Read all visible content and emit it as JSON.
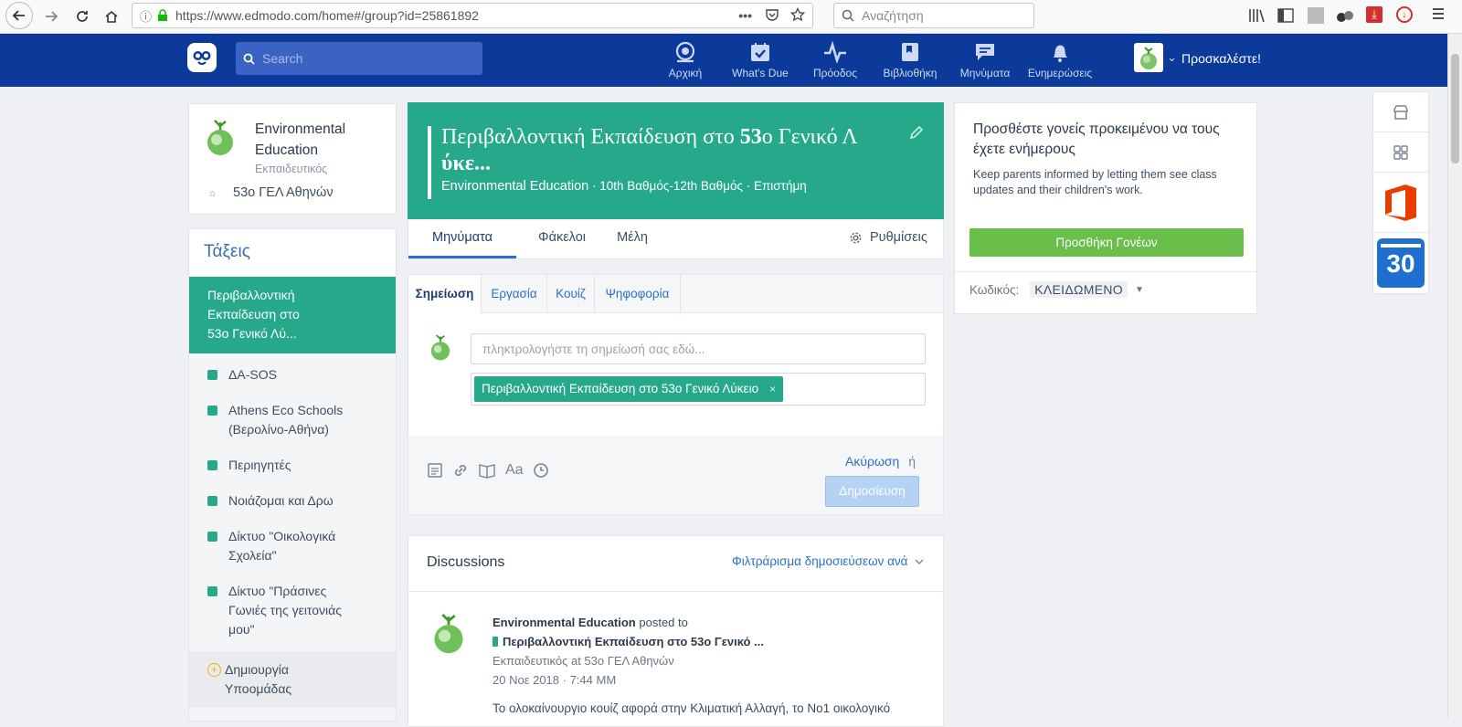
{
  "browser": {
    "url": "https://www.edmodo.com/home#/group?id=25861892",
    "url_domain": "edmodo.com",
    "search_placeholder": "Αναζήτηση"
  },
  "navbar": {
    "search_placeholder": "Search",
    "items": [
      {
        "label": "Αρχική",
        "icon": "home-icon"
      },
      {
        "label": "What's Due",
        "icon": "calendar-check-icon"
      },
      {
        "label": "Πρόοδος",
        "icon": "pulse-icon"
      },
      {
        "label": "Βιβλιοθήκη",
        "icon": "library-icon"
      },
      {
        "label": "Μηνύματα",
        "icon": "chat-icon"
      },
      {
        "label": "Ενημερώσεις",
        "icon": "bell-icon"
      }
    ],
    "invite_label": "Προσκαλέστε!"
  },
  "profile": {
    "name": "Environmental Education",
    "role": "Εκπαιδευτικός",
    "school": "53ο ΓΕΛ Αθηνών"
  },
  "sidebar": {
    "title": "Τάξεις",
    "active_group": "Περιβαλλοντική Εκπαίδευση στο 53ο Γενικό Λύ...",
    "groups": [
      {
        "label": "ΔΑ-SOS"
      },
      {
        "label": "Athens Eco Schools (Βερολίνο-Αθήνα)"
      },
      {
        "label": "Περιηγητές"
      },
      {
        "label": "Νοιάζομαι και Δρω"
      },
      {
        "label": "Δίκτυο \"Οικολογικά Σχολεία\""
      },
      {
        "label": "Δίκτυο \"Πράσινες Γωνιές της γειτονιάς μου\""
      }
    ],
    "create_subgroup": "Δημιουργία Υποομάδας"
  },
  "group_header": {
    "title_a": "Περιβαλλοντική Εκπαίδευση στο ",
    "title_b": "53",
    "title_c": "ο Γενικό Λ",
    "title_d": "ύκε...",
    "subtitle_owner": "Environmental Education",
    "subtitle_rest": " · 10th Βαθμός-12th Βαθμός · Επιστήμη",
    "color": "#26a98a"
  },
  "group_tabs": {
    "messages": "Μηνύματα",
    "folders": "Φάκελοι",
    "members": "Μέλη",
    "settings": "Ρυθμίσεις"
  },
  "composer": {
    "tabs": [
      "Σημείωση",
      "Εργασία",
      "Κουίζ",
      "Ψηφοφορία"
    ],
    "placeholder": "πληκτρολογήστε τη σημείωσή σας εδώ...",
    "recipient": "Περιβαλλοντική Εκπαίδευση στο 53ο Γενικό Λύκειο",
    "recipient_remove": "×",
    "cancel": "Ακύρωση",
    "or": "ή",
    "post": "Δημοσίευση",
    "tool_font": "Aa"
  },
  "discussions": {
    "title": "Discussions",
    "filter": "Φιλτράρισμα δημοσιεύσεων ανά",
    "post": {
      "author": "Environmental Education",
      "posted_to": "posted to",
      "group": "Περιβαλλοντική Εκπαίδευση στο 53ο Γενικό ...",
      "meta": "Εκπαιδευτικός at 53ο ΓΕΛ Αθηνών",
      "date": "20 Νοε 2018 · 7:44 ΜΜ",
      "text": "Το ολοκαίνουργιο κουίζ αφορά στην Κλιματική Αλλαγή, το Νο1 οικολογικό"
    }
  },
  "parents_card": {
    "title": "Προσθέστε γονείς προκειμένου να τους έχετε ενήμερους",
    "body": "Keep parents informed by letting them see class updates and their children's work.",
    "button": "Προσθήκη Γονέων",
    "code_label": "Κωδικός:",
    "code_value": "ΚΛΕΙΔΩΜΕΝΟ"
  },
  "apps_rail": {
    "calendar_day": "30"
  },
  "colors": {
    "navbar": "#0c3a9b",
    "teal": "#26a98a",
    "green_button": "#6abf4b",
    "link": "#2a6fc9"
  }
}
